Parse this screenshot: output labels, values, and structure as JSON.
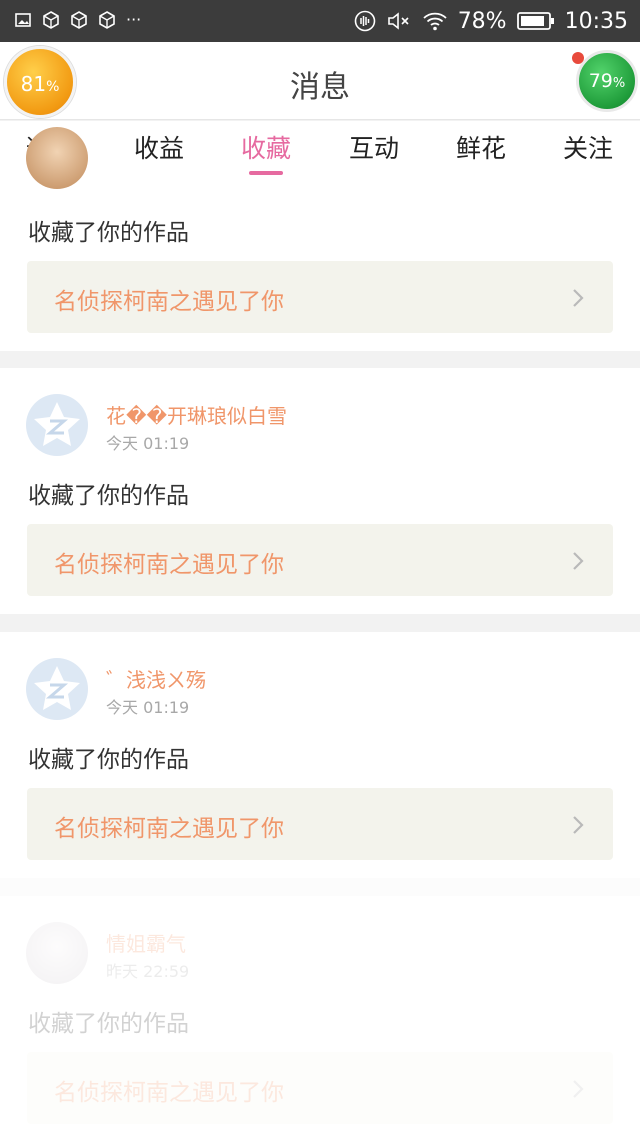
{
  "status_bar": {
    "battery_percent": "78%",
    "time": "10:35",
    "left_icons": [
      "image-icon",
      "package-icon",
      "package-icon",
      "package-icon"
    ],
    "overflow": "···"
  },
  "header": {
    "title": "消息",
    "left_badge": {
      "value": "81",
      "unit": "%"
    },
    "right_badge": {
      "value": "79",
      "unit": "%"
    }
  },
  "tabs": [
    {
      "label": "通知",
      "active": false
    },
    {
      "label": "收益",
      "active": false
    },
    {
      "label": "收藏",
      "active": true
    },
    {
      "label": "互动",
      "active": false
    },
    {
      "label": "鲜花",
      "active": false
    },
    {
      "label": "关注",
      "active": false
    }
  ],
  "colors": {
    "accent": "#e66aa0",
    "link": "#f0966a"
  },
  "items": [
    {
      "user": "",
      "time": "",
      "action": "收藏了你的作品",
      "work": "名侦探柯南之遇见了你"
    },
    {
      "user": "花��开琳琅似白雪",
      "time": "今天 01:19",
      "action": "收藏了你的作品",
      "work": "名侦探柯南之遇见了你"
    },
    {
      "user": "゛浅浅ㄨ殇",
      "time": "今天 01:19",
      "action": "收藏了你的作品",
      "work": "名侦探柯南之遇见了你"
    },
    {
      "user": "情姐霸气",
      "time": "昨天 22:59",
      "action": "收藏了你的作品",
      "work": "名侦探柯南之遇见了你"
    }
  ]
}
